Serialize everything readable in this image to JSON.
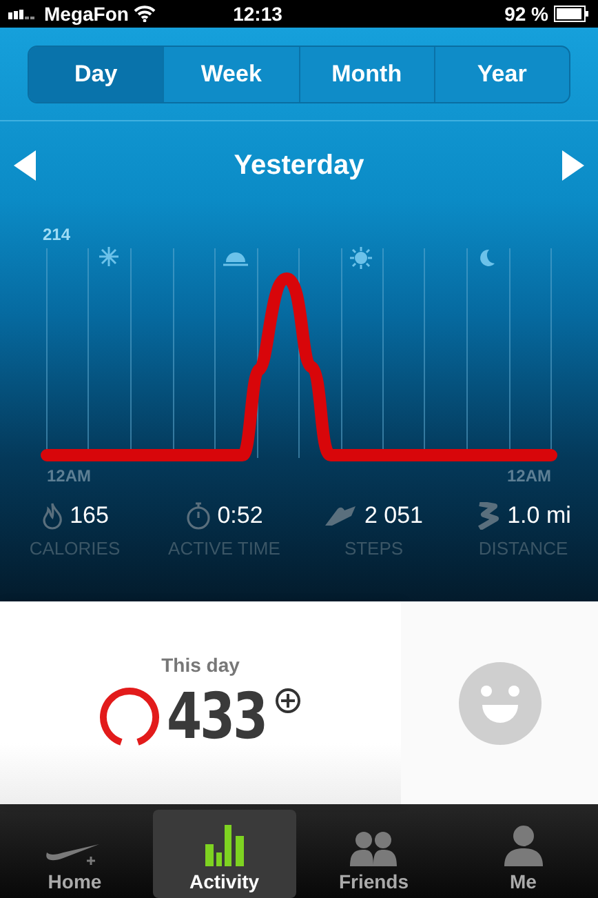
{
  "status_bar": {
    "carrier": "MegaFon",
    "time": "12:13",
    "battery": "92 %"
  },
  "tabs": [
    {
      "label": "Day",
      "selected": true
    },
    {
      "label": "Week",
      "selected": false
    },
    {
      "label": "Month",
      "selected": false
    },
    {
      "label": "Year",
      "selected": false
    }
  ],
  "period": {
    "title": "Yesterday"
  },
  "chart": {
    "max_label": "214",
    "start_label": "12AM",
    "end_label": "12AM"
  },
  "stats": [
    {
      "kind": "calories",
      "value": "165",
      "label": "CALORIES"
    },
    {
      "kind": "time",
      "value": "0:52",
      "label": "ACTIVE TIME"
    },
    {
      "kind": "steps",
      "value": "2 051",
      "label": "STEPS"
    },
    {
      "kind": "distance",
      "value": "1.0 mi",
      "label": "DISTANCE"
    }
  ],
  "summary": {
    "title": "This day",
    "points": "433"
  },
  "tab_bar": [
    {
      "kind": "home",
      "label": "Home",
      "selected": false
    },
    {
      "kind": "activity",
      "label": "Activity",
      "selected": true
    },
    {
      "kind": "friends",
      "label": "Friends",
      "selected": false
    },
    {
      "kind": "me",
      "label": "Me",
      "selected": false
    }
  ]
}
